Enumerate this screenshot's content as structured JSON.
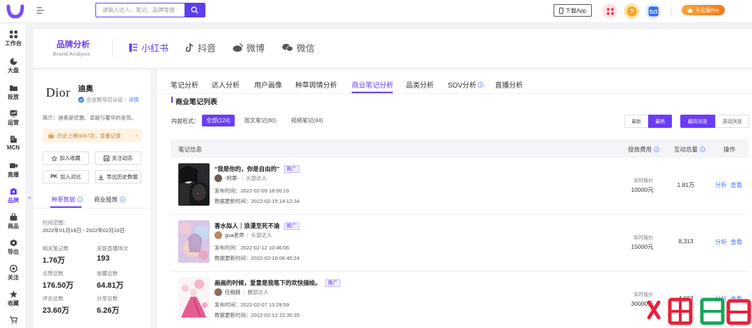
{
  "colors": {
    "brand": "#6a3cf5",
    "link": "#4c7af5",
    "orange": "#f27b1d"
  },
  "topbar": {
    "search_placeholder": "请输入达人、笔记、品牌等搜",
    "download_label": "下载App",
    "pro_label": "专业版Pro",
    "icons": [
      "logo-icon",
      "menu-toggle-icon",
      "search-icon",
      "phone-icon",
      "apps-icon",
      "help-icon",
      "message-icon",
      "crown-icon"
    ]
  },
  "sidebar": {
    "items": [
      {
        "label": "工作台",
        "icon": "grid-icon"
      },
      {
        "label": "大盘",
        "icon": "pie-icon"
      },
      {
        "label": "投放",
        "icon": "folder-icon"
      },
      {
        "label": "运营",
        "icon": "chart-icon"
      },
      {
        "label": "MCN",
        "icon": "building-icon"
      },
      {
        "label": "直播",
        "icon": "video-icon"
      },
      {
        "label": "品牌",
        "icon": "brand-icon"
      },
      {
        "label": "商品",
        "icon": "bag-icon"
      },
      {
        "label": "导出",
        "icon": "export-icon"
      },
      {
        "label": "关注",
        "icon": "eye-icon"
      },
      {
        "label": "收藏",
        "icon": "star-icon"
      },
      {
        "label": "",
        "icon": "cart-icon"
      }
    ],
    "active_index": 6,
    "collapse": "»"
  },
  "brand_header": {
    "title": "品牌分析",
    "subtitle": "Brand Analysis",
    "platforms": [
      {
        "label": "小红书",
        "icon": "xiaohongshu-icon",
        "active": true
      },
      {
        "label": "抖音",
        "icon": "douyin-icon",
        "active": false
      },
      {
        "label": "微博",
        "icon": "weibo-icon",
        "active": false
      },
      {
        "label": "微信",
        "icon": "wechat-icon",
        "active": false
      }
    ]
  },
  "brand": {
    "logo_text": "Dior",
    "name": "迪奥",
    "verify": "企业账号已认证",
    "verify_link": "详情",
    "intro": "简介：迪奥是优雅、卓越与奢华的呈现。",
    "history": "历史上榜3067次，查看记录",
    "buttons": {
      "favorite": "加入收藏",
      "follow": "关注动态",
      "compare": "加入对比",
      "export": "导出历史数据"
    },
    "tabs": [
      "种草数据",
      "商业投放"
    ],
    "range_label": "时间范围：",
    "range_value": "2022年01月18日 - 2022年02月16日",
    "stats": [
      {
        "label": "相关笔记数",
        "value": "1.76万"
      },
      {
        "label": "关联直播场次",
        "value": "193"
      },
      {
        "label": "点赞总数",
        "value": "176.50万"
      },
      {
        "label": "收藏总数",
        "value": "64.81万"
      },
      {
        "label": "评论总数",
        "value": "23.60万"
      },
      {
        "label": "分享总数",
        "value": "6.26万"
      }
    ]
  },
  "main": {
    "tabs": [
      "笔记分析",
      "达人分析",
      "用户画像",
      "种草舆情分析",
      "商业笔记分析",
      "品类分析",
      "SOV分析",
      "直播分析"
    ],
    "active_tab": 4,
    "section_title": "商业笔记列表",
    "filter_label": "内容形式：",
    "filters": [
      "全部(124)",
      "图文笔记(80)",
      "视频笔记(44)"
    ],
    "sort": [
      "最新",
      "最热"
    ],
    "view": [
      "翻页浏览",
      "滚动浏览"
    ],
    "columns": {
      "info": "笔记信息",
      "fee": "投放费用",
      "interact": "互动总量",
      "action": "操作"
    },
    "rows": [
      {
        "title": "“我是你的，你是自由的”",
        "tag": "推广",
        "author": "-阿萘-",
        "role": "头部达人",
        "publish": "发布时间：2022-02-09 18:00:16",
        "update": "数据更新时间：2022-02-15 14:12:34",
        "fee_label": "实时报价",
        "fee": "10000元",
        "interact": "1.81万",
        "analyze": "分析",
        "view": "查看"
      },
      {
        "title": "香水拟人｜浪漫至死不渝",
        "tag": "推广",
        "author": "gua老师",
        "role": "头部达人",
        "publish": "发布时间：2022-02-12 10:46:06",
        "update": "数据更新时间：2022-02-16 06:45:24",
        "fee_label": "实时报价",
        "fee": "15000元",
        "interact": "8,313",
        "analyze": "分析",
        "view": "查看"
      },
      {
        "title": "画画的时候，爱意是我笔下的欢快描绘。",
        "tag": "推广",
        "author": "任桃桃",
        "role": "腰部达人",
        "publish": "发布时间：2022-02-07 13:29:59",
        "update": "数据更新时间：2022-02-12 22:30:35",
        "fee_label": "实时报价",
        "fee": "30000元",
        "interact": "4,693",
        "analyze": "分析",
        "view": "查看"
      }
    ]
  }
}
